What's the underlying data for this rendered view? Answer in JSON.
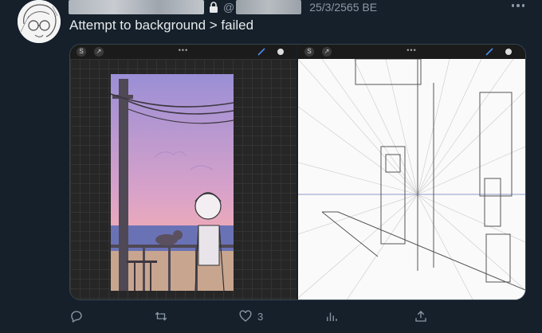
{
  "tweet": {
    "date": "25/3/2565 BE",
    "at_symbol": "@",
    "text": "Attempt to background > failed"
  },
  "media": {
    "left_app_toolbar": {
      "dots": "•••"
    },
    "right_app_toolbar": {
      "dots": "•••"
    }
  },
  "actions": {
    "reply_count": "",
    "retweet_count": "",
    "like_count": "3"
  },
  "colors": {
    "background": "#15202b",
    "text": "#e7e9ea",
    "muted": "#8b98a5",
    "sky_top": "#9a8fd6",
    "sky_bottom": "#e3a5c0",
    "sea": "#6a72b6"
  },
  "icons": [
    "lock-icon",
    "more-icon",
    "reply-icon",
    "retweet-icon",
    "like-icon",
    "analytics-icon",
    "share-icon"
  ]
}
